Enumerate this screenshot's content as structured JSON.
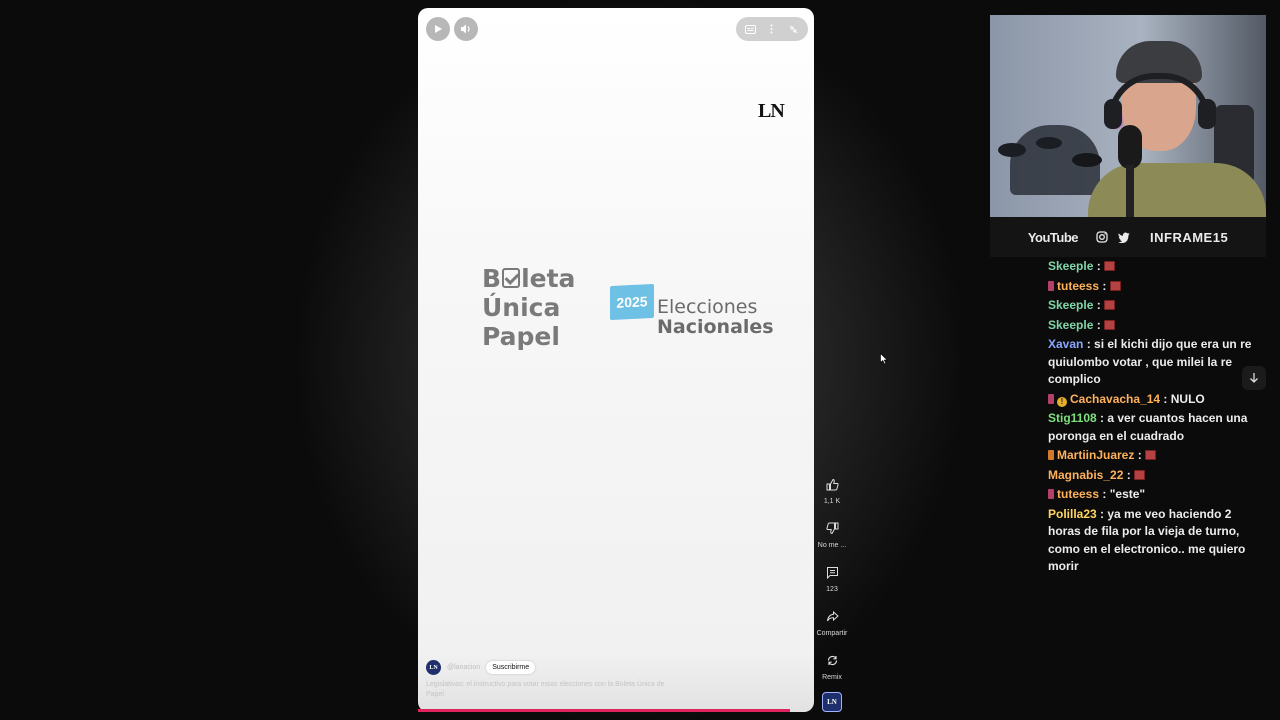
{
  "short": {
    "player_controls": {
      "play": "play-icon",
      "volume": "volume-icon",
      "captions": "captions-icon",
      "more": "more-vert-icon",
      "minimize": "collapse-icon"
    },
    "brand_logo": "LN",
    "graphic": {
      "boleta_line1_pre": "B",
      "boleta_line1_post": "leta",
      "boleta_line2": "Única",
      "boleta_line3": "Papel",
      "flag_year": "2025",
      "elecciones_line1": "Elecciones",
      "elecciones_line2": "Nacionales"
    },
    "channel": {
      "avatar_text": "LN",
      "name": "@lanacion",
      "subscribe_label": "Suscribirme"
    },
    "caption": "Legislativas: el instructivo para votar estas elecciones con la Boleta Única de Papel",
    "progress": 0.94,
    "colors": {
      "progress": "#e0245e",
      "flag": "#6ec1e4"
    }
  },
  "actions": [
    {
      "name": "like",
      "icon": "thumbs-up-icon",
      "label": "1,1 K"
    },
    {
      "name": "dislike",
      "icon": "thumbs-down-icon",
      "label": "No me ..."
    },
    {
      "name": "comments",
      "icon": "comment-icon",
      "label": "123"
    },
    {
      "name": "share",
      "icon": "share-icon",
      "label": "Compartir"
    },
    {
      "name": "remix",
      "icon": "remix-icon",
      "label": "Remix"
    }
  ],
  "remix_thumb": "LN",
  "overlay": {
    "socials_youtube": "YouTube",
    "socials_handle": "INFRAME15"
  },
  "chat": [
    {
      "user": "Skeeple",
      "color": "#7fd6a8",
      "badge": "",
      "text": "",
      "emote": true
    },
    {
      "user": "tuteess",
      "color": "#ffb15c",
      "badge": "r",
      "text": "",
      "emote": true
    },
    {
      "user": "Skeeple",
      "color": "#7fd6a8",
      "badge": "",
      "text": "",
      "emote": true
    },
    {
      "user": "Skeeple",
      "color": "#7fd6a8",
      "badge": "",
      "text": "",
      "emote": true
    },
    {
      "user": "Xavan",
      "color": "#8aa7ff",
      "badge": "",
      "text": "si el kichi dijo que era un re quiulombo votar , que milei la re complico",
      "emote": false
    },
    {
      "user": "Cachavacha_14",
      "color": "#ffb15c",
      "badge": "rc",
      "text": "NULO",
      "emote": false
    },
    {
      "user": "Stig1108",
      "color": "#7de07d",
      "badge": "",
      "text": "a ver cuantos hacen una poronga en el cuadrado",
      "emote": false
    },
    {
      "user": "MartiinJuarez",
      "color": "#ffb15c",
      "badge": "o",
      "text": "",
      "emote": true
    },
    {
      "user": "Magnabis_22",
      "color": "#ffb15c",
      "badge": "",
      "text": "",
      "emote": true
    },
    {
      "user": "tuteess",
      "color": "#ffb15c",
      "badge": "r",
      "text": "\"este\"",
      "emote": false
    },
    {
      "user": "Polilla23",
      "color": "#ffd75c",
      "badge": "",
      "text": "ya me veo haciendo 2 horas de fila por la vieja de turno, como en el electronico.. me quiero morir",
      "emote": false
    }
  ]
}
